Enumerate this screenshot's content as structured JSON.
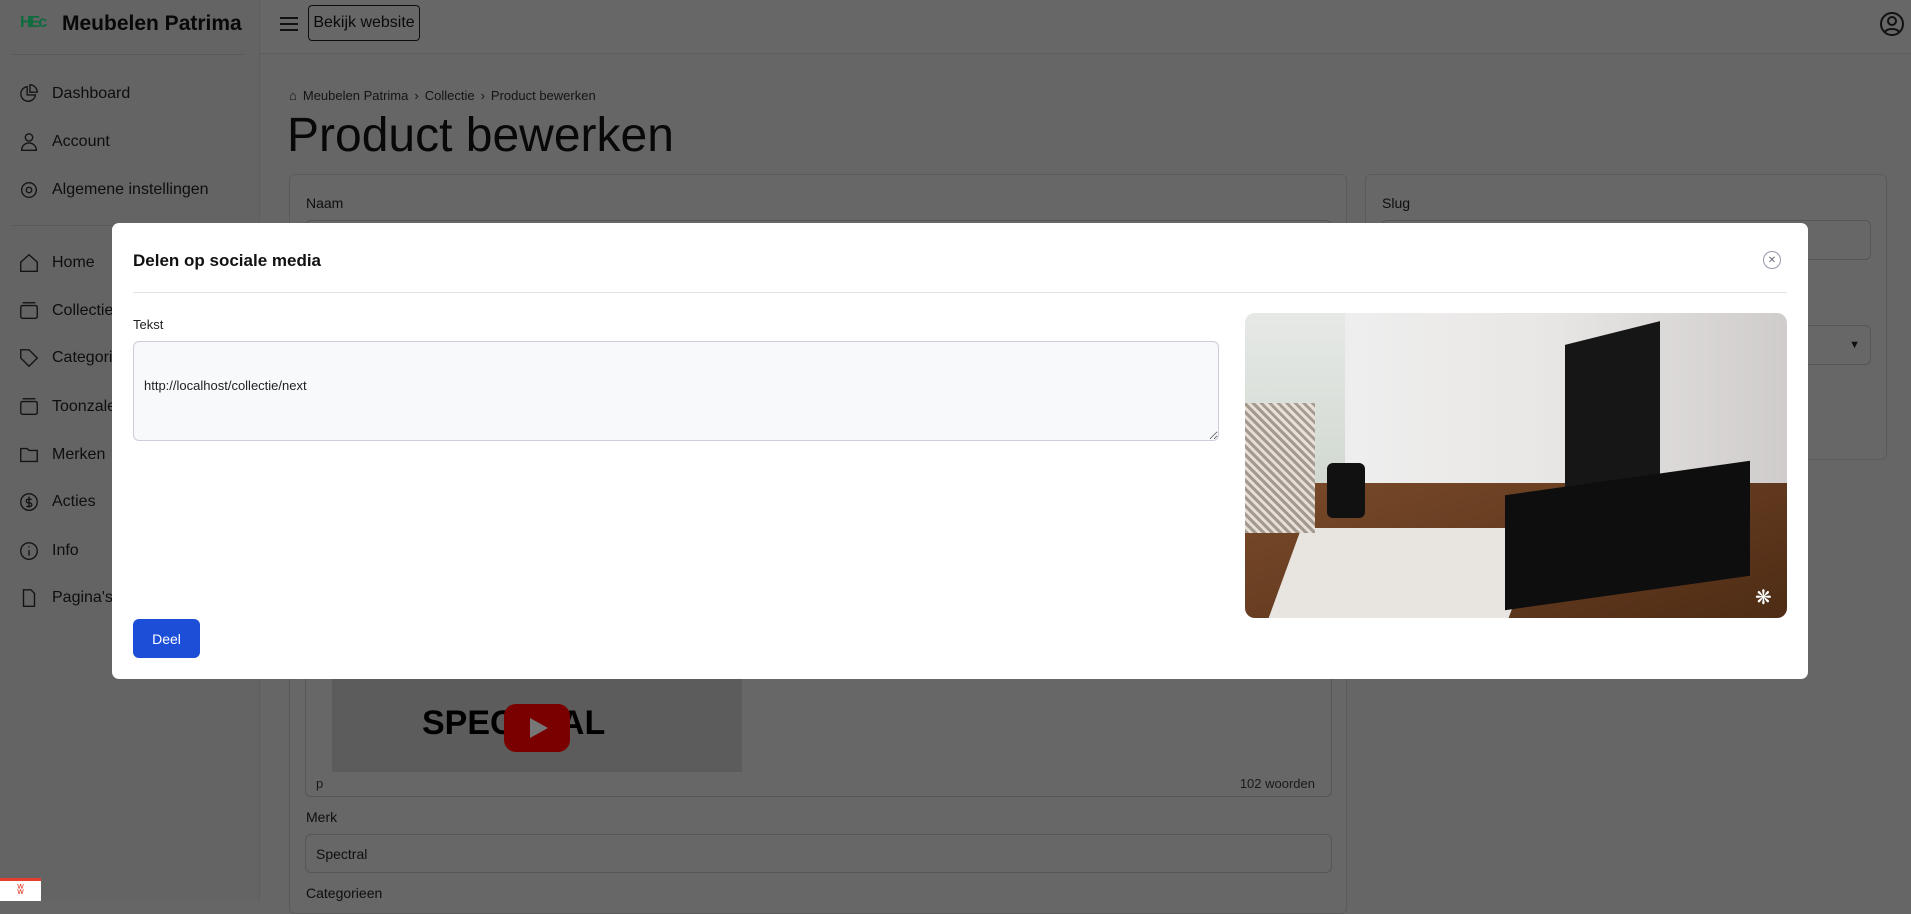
{
  "app": {
    "name": "Meubelen Patrima",
    "logo_text": "HEc",
    "view_site": "Bekijk website"
  },
  "sidebar": {
    "items": [
      {
        "label": "Dashboard",
        "icon": "pie-chart-icon"
      },
      {
        "label": "Account",
        "icon": "user-icon"
      },
      {
        "label": "Algemene instellingen",
        "icon": "gear-icon"
      },
      {
        "label": "Home",
        "icon": "home-icon"
      },
      {
        "label": "Collectie",
        "icon": "archive-icon"
      },
      {
        "label": "Categorieën",
        "icon": "tag-icon"
      },
      {
        "label": "Toonzalen",
        "icon": "archive-icon"
      },
      {
        "label": "Merken",
        "icon": "folder-icon"
      },
      {
        "label": "Acties",
        "icon": "dollar-icon"
      },
      {
        "label": "Info",
        "icon": "info-icon"
      },
      {
        "label": "Pagina's",
        "icon": "file-icon"
      }
    ]
  },
  "breadcrumb": [
    "Meubelen Patrima",
    "Collectie",
    "Product bewerken"
  ],
  "page": {
    "title": "Product bewerken",
    "name_label": "Naam",
    "slug_label": "Slug",
    "editor_path": "p",
    "word_count": "102 woorden",
    "video_brand": "SPECTRAL",
    "merk_label": "Merk",
    "merk_value": "Spectral",
    "categories_label": "Categorieen"
  },
  "modal": {
    "title": "Delen op sociale media",
    "text_label": "Tekst",
    "text_value": "http://localhost/collectie/next",
    "share_button": "Deel"
  },
  "colors": {
    "primary": "#1d4ed8",
    "overlay": "rgba(0,0,0,0.6)"
  }
}
